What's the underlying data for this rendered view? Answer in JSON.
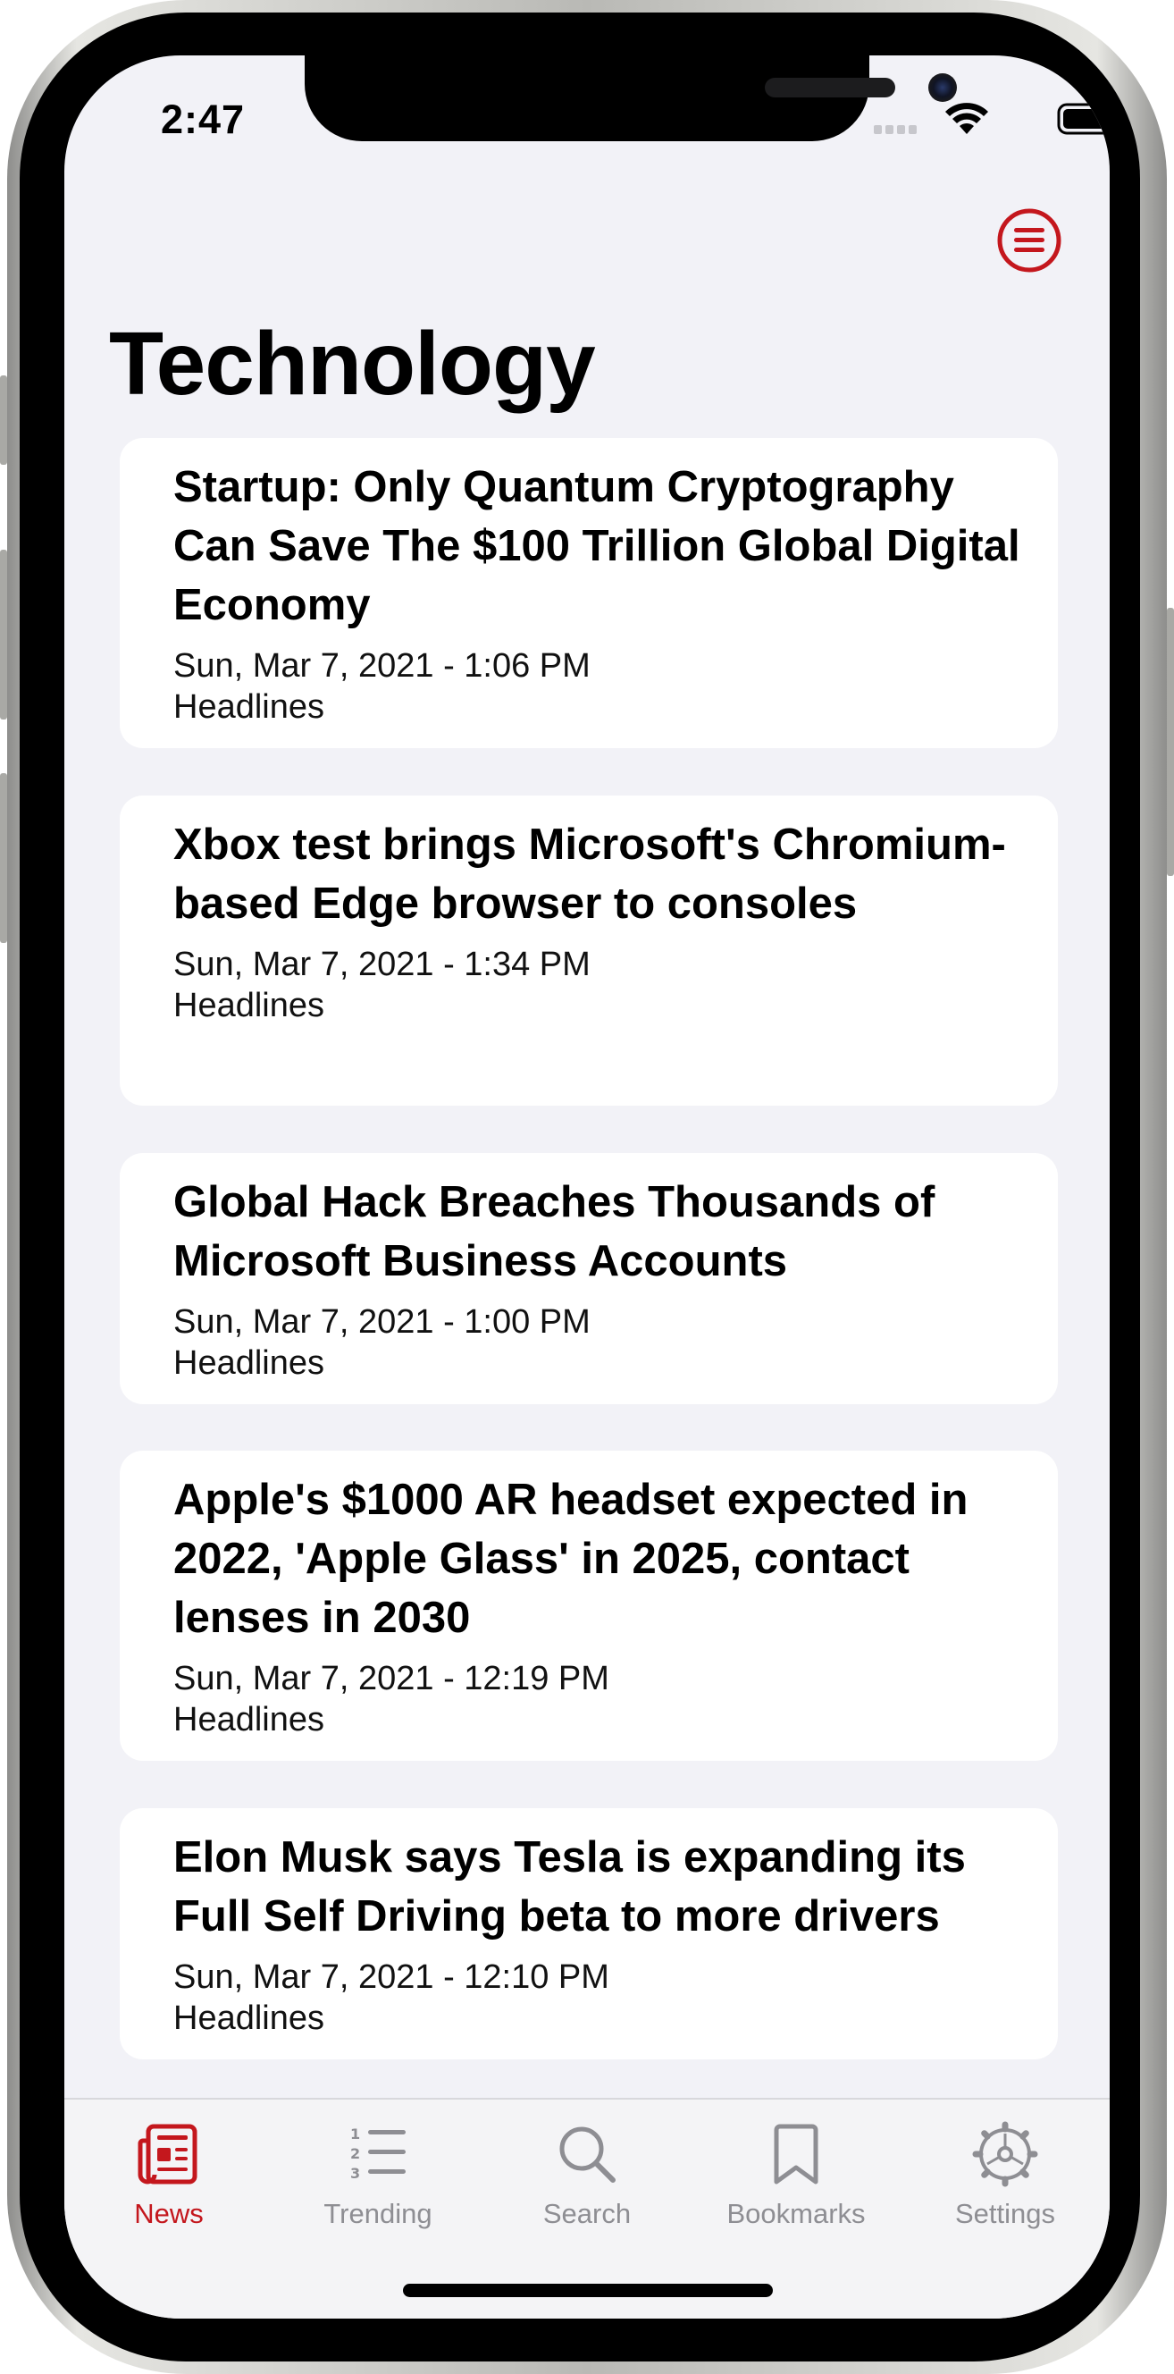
{
  "status_bar": {
    "time": "2:47"
  },
  "header": {
    "title": "Technology"
  },
  "colors": {
    "accent": "#c4171d",
    "background": "#f2f2f7",
    "card": "#ffffff",
    "inactive": "#8e8e93"
  },
  "articles": [
    {
      "title": "Startup: Only Quantum Cryptography Can Save The $100 Trillion Global Digital Economy",
      "date": "Sun, Mar 7, 2021 - 1:06 PM",
      "source": "Headlines"
    },
    {
      "title": "Xbox test brings Microsoft's Chromium-based Edge browser to consoles",
      "date": "Sun, Mar 7, 2021 - 1:34 PM",
      "source": "Headlines"
    },
    {
      "title": "Global Hack Breaches Thousands of Microsoft Business Accounts",
      "date": "Sun, Mar 7, 2021 - 1:00 PM",
      "source": "Headlines"
    },
    {
      "title": "Apple's $1000 AR headset expected in 2022, 'Apple Glass' in 2025, contact lenses in 2030",
      "date": "Sun, Mar 7, 2021 - 12:19 PM",
      "source": "Headlines"
    },
    {
      "title": "Elon Musk says Tesla is expanding its Full Self Driving beta to more drivers",
      "date": "Sun, Mar 7, 2021 - 12:10 PM",
      "source": "Headlines"
    }
  ],
  "tabs": [
    {
      "label": "News",
      "icon": "newspaper-icon",
      "active": true
    },
    {
      "label": "Trending",
      "icon": "numbered-list-icon",
      "active": false
    },
    {
      "label": "Search",
      "icon": "magnifier-icon",
      "active": false
    },
    {
      "label": "Bookmarks",
      "icon": "bookmark-icon",
      "active": false
    },
    {
      "label": "Settings",
      "icon": "gear-icon",
      "active": false
    }
  ]
}
